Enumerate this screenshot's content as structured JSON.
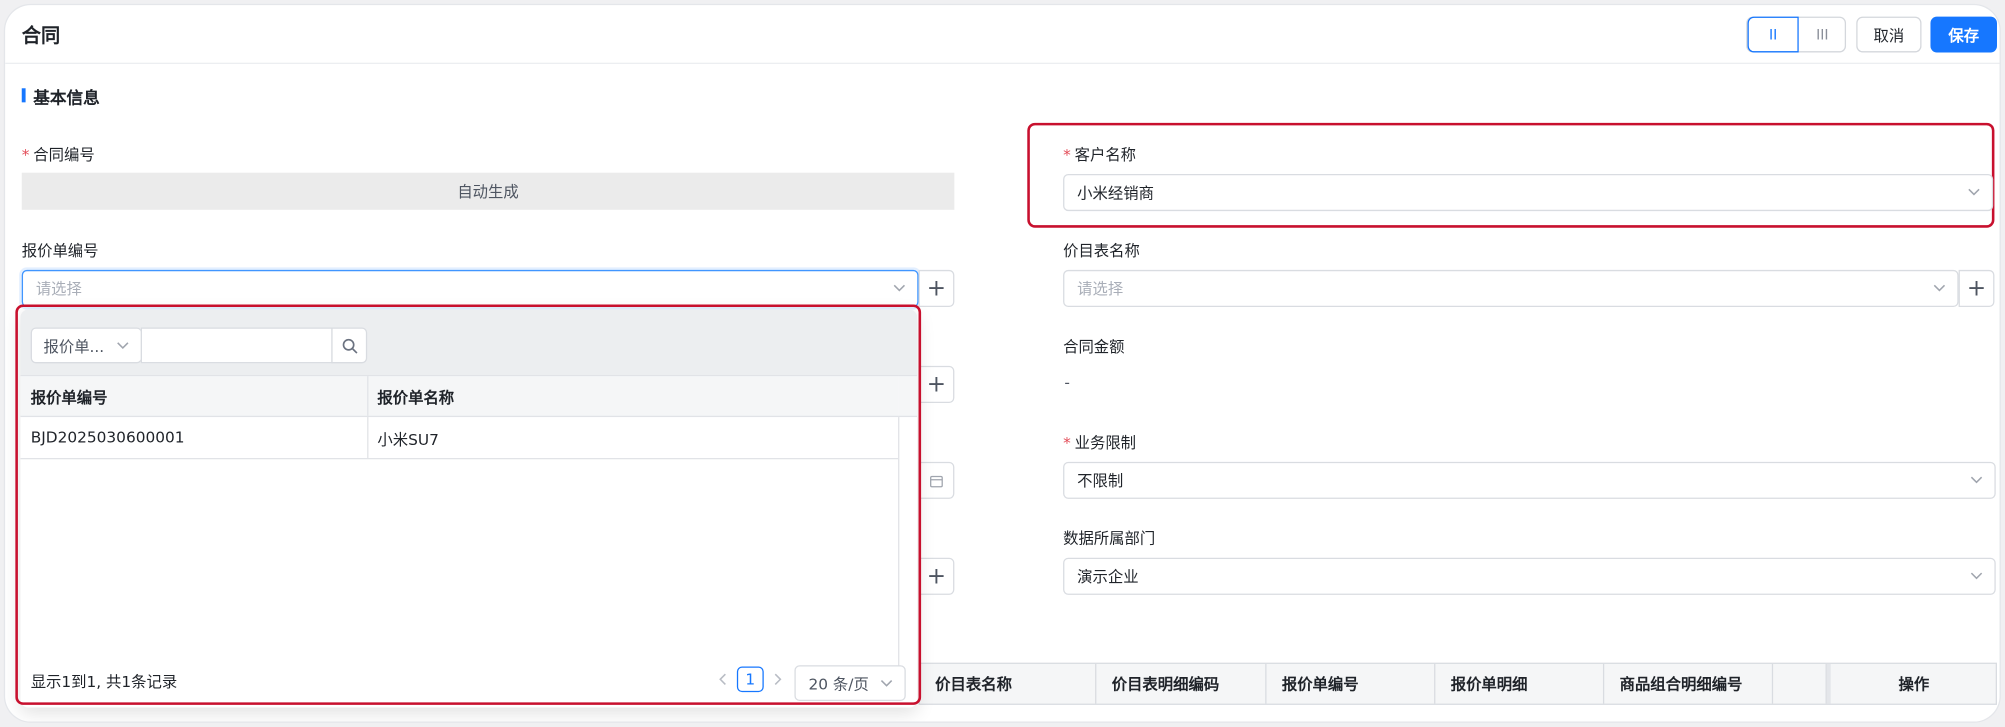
{
  "header": {
    "title": "合同",
    "view_two_col": "II",
    "view_three_col": "III",
    "cancel_label": "取消",
    "save_label": "保存"
  },
  "section": {
    "title": "基本信息"
  },
  "fields": {
    "contract_no": {
      "label": "合同编号",
      "required": "*",
      "value": "自动生成"
    },
    "customer": {
      "label": "客户名称",
      "required": "*",
      "value": "小米经销商"
    },
    "quote_no": {
      "label": "报价单编号",
      "placeholder": "请选择"
    },
    "price_list": {
      "label": "价目表名称",
      "placeholder": "请选择"
    },
    "amount": {
      "label": "合同金额",
      "value": "-"
    },
    "biz_limit": {
      "label": "业务限制",
      "required": "*",
      "value": "不限制"
    },
    "dept": {
      "label": "数据所属部门",
      "value": "演示企业"
    }
  },
  "dropdown": {
    "filter_field": "报价单...",
    "search_value": "",
    "columns": [
      "报价单编号",
      "报价单名称"
    ],
    "rows": [
      {
        "code": "BJD2025030600001",
        "name": "小米SU7"
      }
    ],
    "summary": "显示1到1, 共1条记录",
    "current_page": "1",
    "page_size": "20 条/页"
  },
  "detail_table": {
    "columns": [
      "价目表名称",
      "价目表明细编码",
      "报价单编号",
      "报价单明细",
      "商品组合明细编号",
      "",
      "操作"
    ]
  }
}
